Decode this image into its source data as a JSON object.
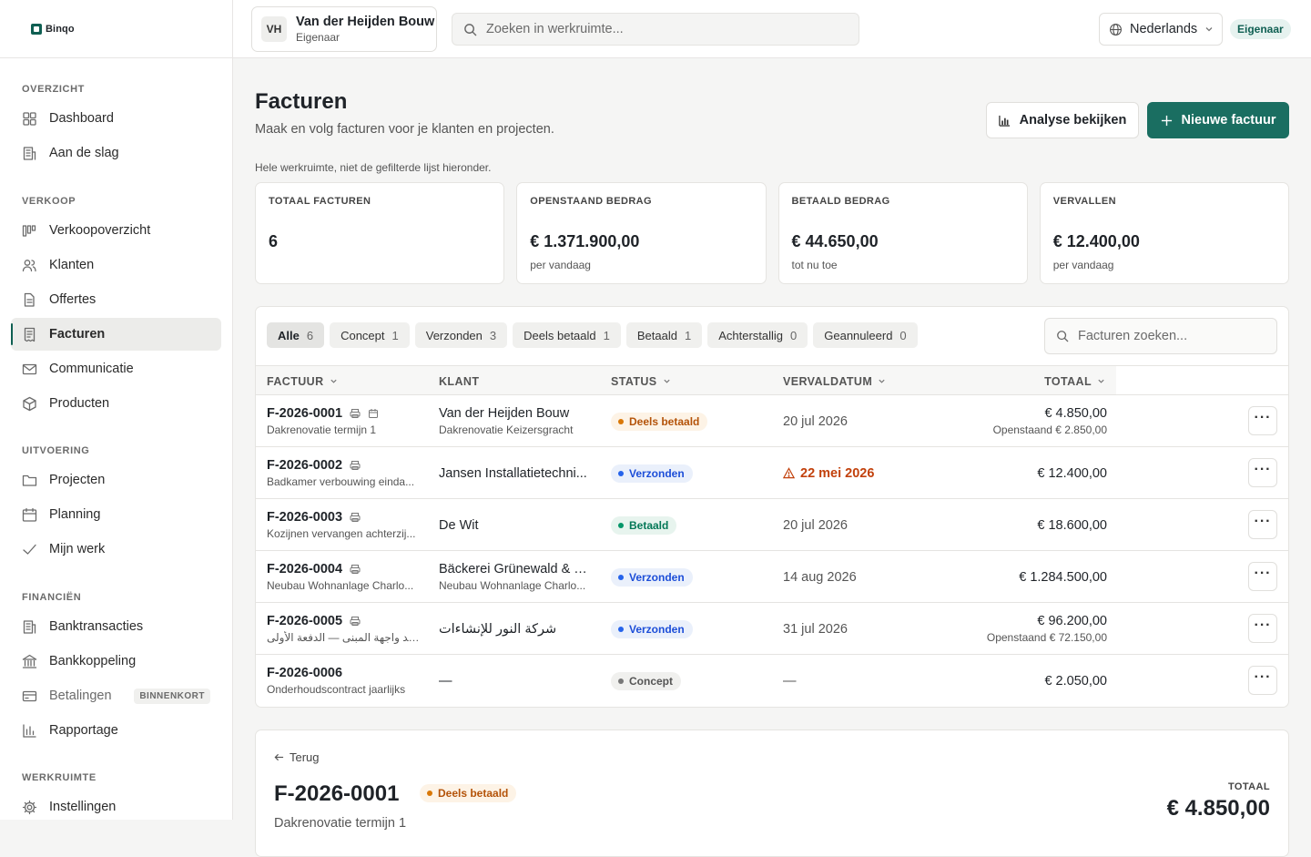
{
  "app": {
    "name": "Binqo"
  },
  "workspace": {
    "initials": "VH",
    "name": "Van der Heijden Bouw",
    "role": "Eigenaar"
  },
  "topbar": {
    "search_placeholder": "Zoeken in werkruimte...",
    "language": "Nederlands",
    "role_badge": "Eigenaar"
  },
  "sidebar": {
    "sections": [
      {
        "heading": "OVERZICHT",
        "items": [
          {
            "label": "Dashboard",
            "icon": "grid-icon"
          },
          {
            "label": "Aan de slag",
            "icon": "building-icon"
          }
        ]
      },
      {
        "heading": "VERKOOP",
        "items": [
          {
            "label": "Verkoopoverzicht",
            "icon": "columns-icon"
          },
          {
            "label": "Klanten",
            "icon": "users-icon"
          },
          {
            "label": "Offertes",
            "icon": "file-icon"
          },
          {
            "label": "Facturen",
            "icon": "receipt-icon",
            "active": true
          },
          {
            "label": "Communicatie",
            "icon": "mail-icon"
          },
          {
            "label": "Producten",
            "icon": "box-icon"
          }
        ]
      },
      {
        "heading": "UITVOERING",
        "items": [
          {
            "label": "Projecten",
            "icon": "folder-icon"
          },
          {
            "label": "Planning",
            "icon": "calendar-icon"
          },
          {
            "label": "Mijn werk",
            "icon": "check-icon"
          }
        ]
      },
      {
        "heading": "FINANCIËN",
        "items": [
          {
            "label": "Banktransacties",
            "icon": "ledger-icon"
          },
          {
            "label": "Bankkoppeling",
            "icon": "bank-icon"
          },
          {
            "label": "Betalingen",
            "icon": "card-icon",
            "badge": "BINNENKORT"
          },
          {
            "label": "Rapportage",
            "icon": "bar-chart-icon"
          }
        ]
      },
      {
        "heading": "WERKRUIMTE",
        "items": [
          {
            "label": "Instellingen",
            "icon": "gear-icon"
          }
        ]
      }
    ]
  },
  "page": {
    "title": "Facturen",
    "subtitle": "Maak en volg facturen voor je klanten en projecten.",
    "analyse_button": "Analyse bekijken",
    "new_button": "Nieuwe factuur",
    "note": "Hele werkruimte, niet de gefilterde lijst hieronder."
  },
  "stats": [
    {
      "label": "TOTAAL FACTUREN",
      "value": "6",
      "sub": ""
    },
    {
      "label": "OPENSTAAND BEDRAG",
      "value": "€ 1.371.900,00",
      "sub": "per vandaag"
    },
    {
      "label": "BETAALD BEDRAG",
      "value": "€ 44.650,00",
      "sub": "tot nu toe"
    },
    {
      "label": "VERVALLEN",
      "value": "€ 12.400,00",
      "sub": "per vandaag"
    }
  ],
  "filters": [
    {
      "label": "Alle",
      "count": "6",
      "active": true
    },
    {
      "label": "Concept",
      "count": "1"
    },
    {
      "label": "Verzonden",
      "count": "3"
    },
    {
      "label": "Deels betaald",
      "count": "1"
    },
    {
      "label": "Betaald",
      "count": "1"
    },
    {
      "label": "Achterstallig",
      "count": "0"
    },
    {
      "label": "Geannuleerd",
      "count": "0"
    }
  ],
  "table": {
    "search_placeholder": "Facturen zoeken...",
    "columns": [
      "FACTUUR",
      "KLANT",
      "STATUS",
      "VERVALDATUM",
      "TOTAAL"
    ],
    "rows": [
      {
        "number": "F-2026-0001",
        "desc": "Dakrenovatie termijn 1",
        "client": "Van der Heijden Bouw",
        "client_sub": "Dakrenovatie Keizersgracht",
        "status": "Deels betaald",
        "due": "20 jul 2026",
        "total": "€ 4.850,00",
        "total_sub": "Openstaand € 2.850,00"
      },
      {
        "number": "F-2026-0002",
        "desc": "Badkamer verbouwing einda...",
        "client": "Jansen Installatietechni...",
        "client_sub": "",
        "status": "Verzonden",
        "due": "22 mei 2026",
        "total": "€ 12.400,00",
        "total_sub": ""
      },
      {
        "number": "F-2026-0003",
        "desc": "Kozijnen vervangen achterzij...",
        "client": "De Wit",
        "client_sub": "",
        "status": "Betaald",
        "due": "20 jul 2026",
        "total": "€ 18.600,00",
        "total_sub": ""
      },
      {
        "number": "F-2026-0004",
        "desc": "Neubau Wohnanlage Charlo...",
        "client": "Bäckerei Grünewald & S...",
        "client_sub": "Neubau Wohnanlage Charlo...",
        "status": "Verzonden",
        "due": "14 aug 2026",
        "total": "€ 1.284.500,00",
        "total_sub": ""
      },
      {
        "number": "F-2026-0005",
        "desc": "تجديد واجهة المبنى — الدفعة الأولى",
        "client": "شركة النور للإنشاءات",
        "client_sub": "",
        "status": "Verzonden",
        "due": "31 jul 2026",
        "total": "€ 96.200,00",
        "total_sub": "Openstaand € 72.150,00"
      },
      {
        "number": "F-2026-0006",
        "desc": "Onderhoudscontract jaarlijks",
        "client": "—",
        "client_sub": "",
        "status": "Concept",
        "due": "—",
        "total": "€ 2.050,00",
        "total_sub": ""
      }
    ]
  },
  "detail": {
    "back": "Terug",
    "number": "F-2026-0001",
    "status": "Deels betaald",
    "desc": "Dakrenovatie termijn 1",
    "total_label": "TOTAAL",
    "total": "€ 4.850,00"
  }
}
